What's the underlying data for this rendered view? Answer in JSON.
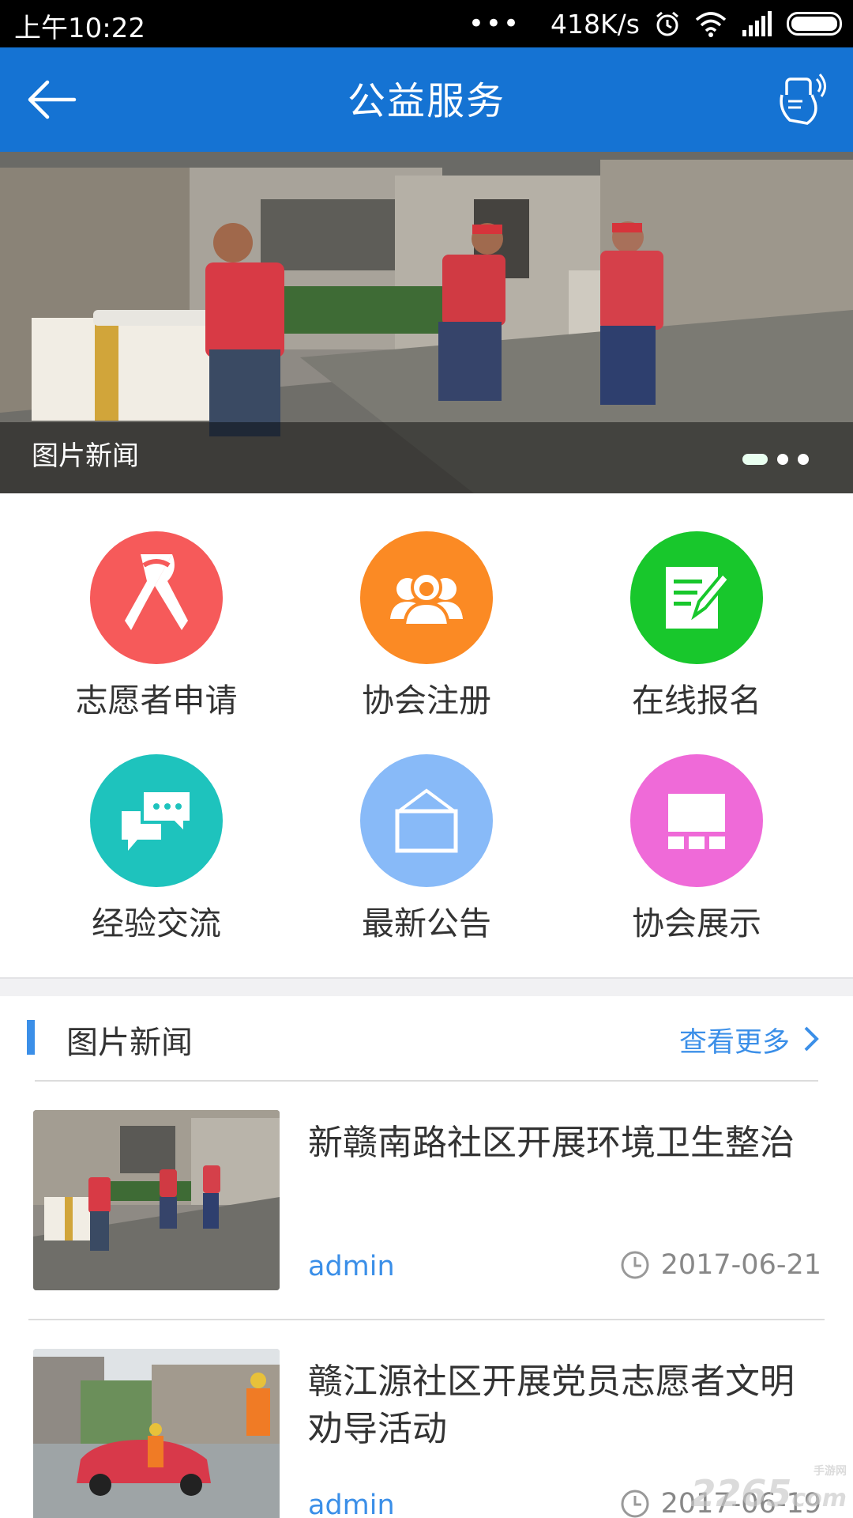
{
  "status_bar": {
    "time": "上午10:22",
    "more": "•••",
    "speed": "418K/s"
  },
  "app_bar": {
    "title": "公益服务",
    "back_icon": "arrow-left-icon",
    "action_icon": "hand-phone-icon"
  },
  "banner": {
    "caption": "图片新闻",
    "page_count": 3,
    "active_page": 1
  },
  "features": [
    {
      "label": "志愿者申请",
      "icon": "ribbon-icon",
      "color": "#f65a5a"
    },
    {
      "label": "协会注册",
      "icon": "people-group-icon",
      "color": "#fb8a24"
    },
    {
      "label": "在线报名",
      "icon": "edit-note-icon",
      "color": "#18c72c"
    },
    {
      "label": "经验交流",
      "icon": "chat-bubbles-icon",
      "color": "#1ec3bd"
    },
    {
      "label": "最新公告",
      "icon": "notice-board-icon",
      "color": "#88baf8"
    },
    {
      "label": "协会展示",
      "icon": "display-board-icon",
      "color": "#ef6ad8"
    }
  ],
  "section": {
    "title": "图片新闻",
    "more_label": "查看更多"
  },
  "news": [
    {
      "headline": "新赣南路社区开展环境卫生整治",
      "author": "admin",
      "date": "2017-06-21"
    },
    {
      "headline": "赣江源社区开展党员志愿者文明劝导活动",
      "author": "admin",
      "date": "2017-06-19"
    }
  ],
  "watermark": {
    "brand": "2265",
    "sub": "手游网",
    "domain": "com"
  }
}
